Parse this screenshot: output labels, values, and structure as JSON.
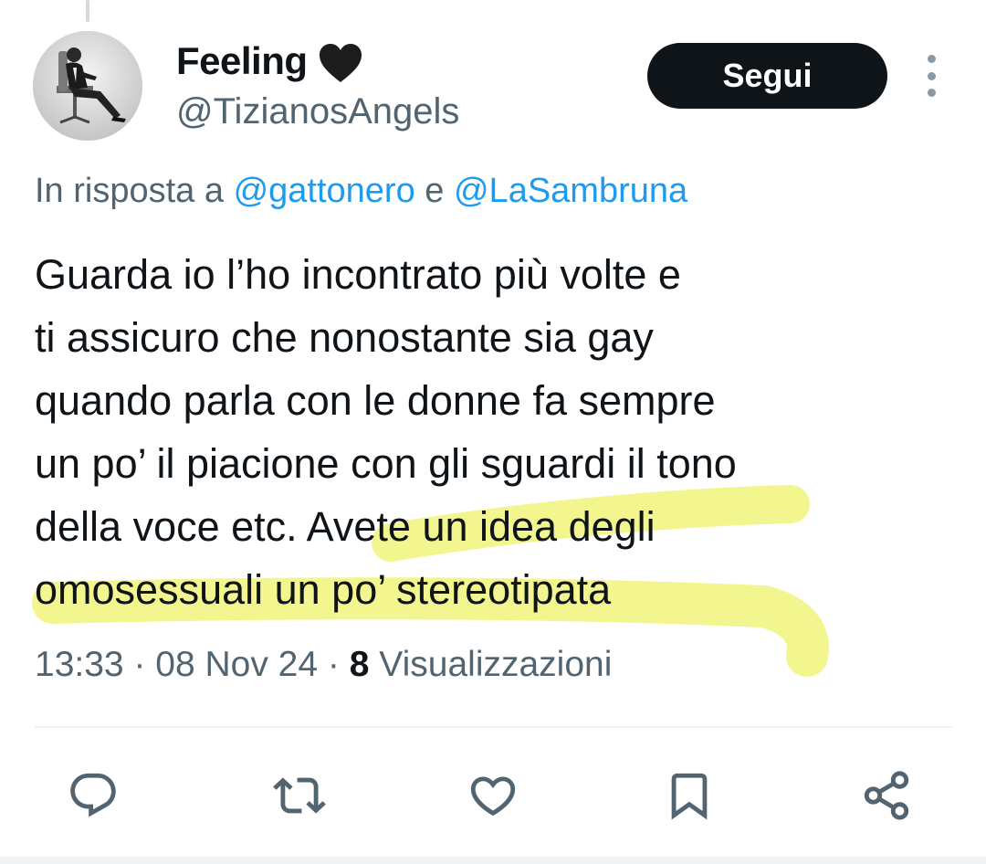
{
  "tweet": {
    "display_name": "Feeling",
    "handle": "@TizianosAngels",
    "follow_label": "Segui",
    "reply": {
      "prefix": "In risposta a",
      "user1": "@gattonero",
      "joiner": "e",
      "user2": "@LaSambruna"
    },
    "text_lines": [
      "Guarda io l’ho incontrato più volte e",
      "ti assicuro che nonostante sia gay",
      "quando parla con le donne fa sempre",
      "un po’ il piacione con gli sguardi il tono",
      "della voce etc. Avete un idea degli",
      "omosessuali un po’ stereotipata"
    ],
    "time": "13:33",
    "date": "08 Nov 24",
    "views_count": "8",
    "views_label": "Visualizzazioni"
  },
  "icons": {
    "name_badge": "black-heart-icon",
    "more": "more-vertical-icon",
    "actions": [
      "reply-icon",
      "retweet-icon",
      "like-icon",
      "bookmark-icon",
      "share-icon"
    ]
  },
  "colors": {
    "link": "#1d9bf0",
    "secondary_text": "#536471",
    "primary_text": "#0f1419",
    "follow_button_bg": "#0f1419",
    "highlighter": "#f2f570"
  }
}
